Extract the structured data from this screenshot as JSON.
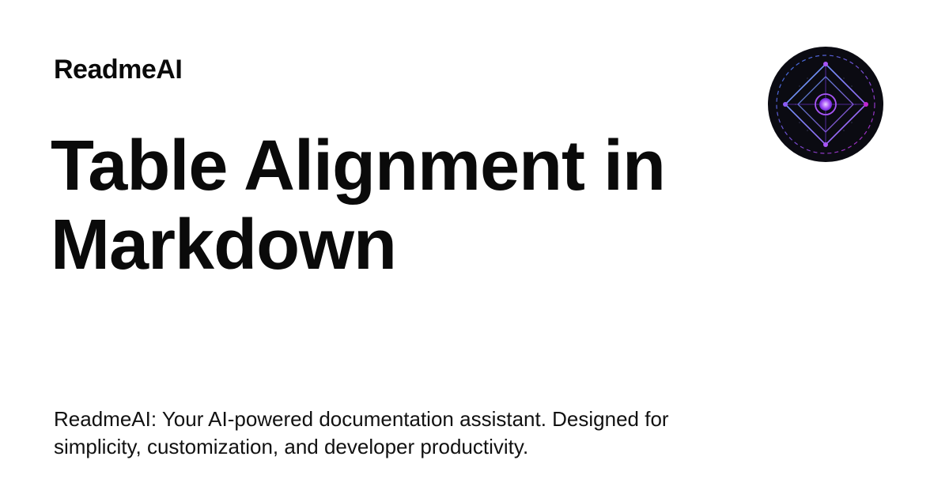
{
  "brand": {
    "name": "ReadmeAI"
  },
  "page": {
    "title": "Table Alignment in Markdown",
    "description": "ReadmeAI: Your AI-powered documentation assistant. Designed for simplicity, customization, and developer productivity."
  },
  "logo": {
    "icon": "diamond-target-icon",
    "colors": {
      "background": "#0b0b12",
      "primary": "#a855f7",
      "secondary": "#3b82f6",
      "accent": "#c026d3"
    }
  }
}
